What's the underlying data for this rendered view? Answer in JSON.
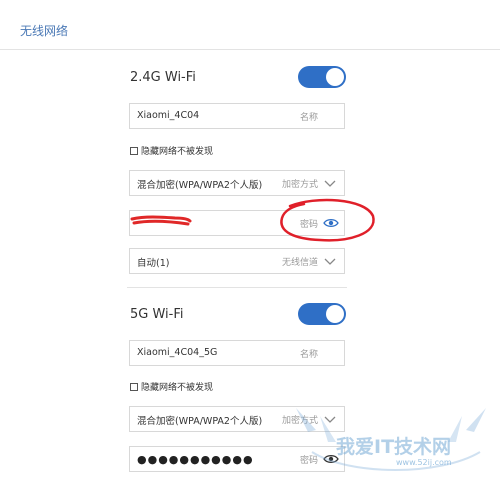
{
  "page": {
    "title": "无线网络"
  },
  "band_24": {
    "label": "2.4G Wi-Fi",
    "enabled": true,
    "ssid_value": "Xiaomi_4C04",
    "ssid_hint": "名称",
    "hide_label": "隐藏网络不被发现",
    "hidden": false,
    "encryption_value": "混合加密(WPA/WPA2个人版)",
    "encryption_hint": "加密方式",
    "password_hint": "密码",
    "channel_value": "自动(1)",
    "channel_hint": "无线信道"
  },
  "band_5": {
    "label": "5G Wi-Fi",
    "enabled": true,
    "ssid_value": "Xiaomi_4C04_5G",
    "ssid_hint": "名称",
    "hide_label": "隐藏网络不被发现",
    "hidden": false,
    "encryption_value": "混合加密(WPA/WPA2个人版)",
    "encryption_hint": "加密方式",
    "password_value": "●●●●●●●●●●●",
    "password_hint": "密码"
  },
  "colors": {
    "accent": "#2f6fc6",
    "title": "#4a78b5",
    "annotation": "#e0202a"
  },
  "watermark": {
    "text": "我爱IT技术网",
    "url": "www.52ij.com"
  }
}
